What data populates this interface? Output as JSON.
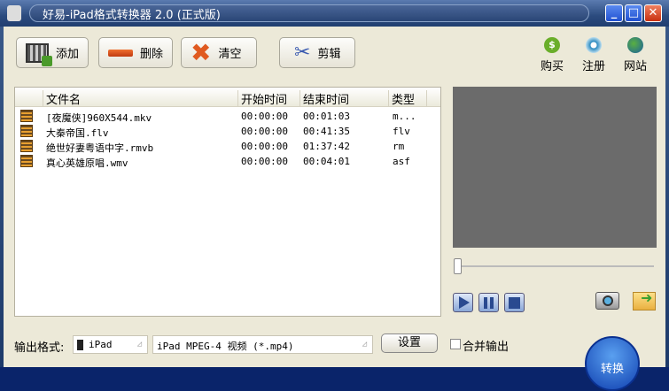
{
  "window": {
    "title": "好易-iPad格式转换器 2.0 (正式版)",
    "minimize": "_",
    "maximize": "□",
    "close": "✕"
  },
  "toolbar": {
    "add": "添加",
    "delete": "删除",
    "clear": "清空",
    "clip": "剪辑"
  },
  "links": {
    "buy": "购买",
    "register": "注册",
    "website": "网站"
  },
  "list": {
    "columns": [
      "文件名",
      "开始时间",
      "结束时间",
      "类型"
    ],
    "rows": [
      {
        "name": "[夜魔侠]960X544.mkv",
        "start": "00:00:00",
        "end": "00:01:03",
        "type": "m..."
      },
      {
        "name": "大秦帝国.flv",
        "start": "00:00:00",
        "end": "00:41:35",
        "type": "flv"
      },
      {
        "name": "绝世好妻粤语中字.rmvb",
        "start": "00:00:00",
        "end": "01:37:42",
        "type": "rm"
      },
      {
        "name": "真心英雄原唱.wmv",
        "start": "00:00:00",
        "end": "00:04:01",
        "type": "asf"
      }
    ]
  },
  "player": {
    "progress": 0
  },
  "output": {
    "label": "输出格式:",
    "device": "iPad",
    "format": "iPad MPEG-4 视频 (*.mp4)",
    "settings": "设置",
    "merge": "合并输出",
    "merge_checked": false,
    "convert": "转换"
  }
}
